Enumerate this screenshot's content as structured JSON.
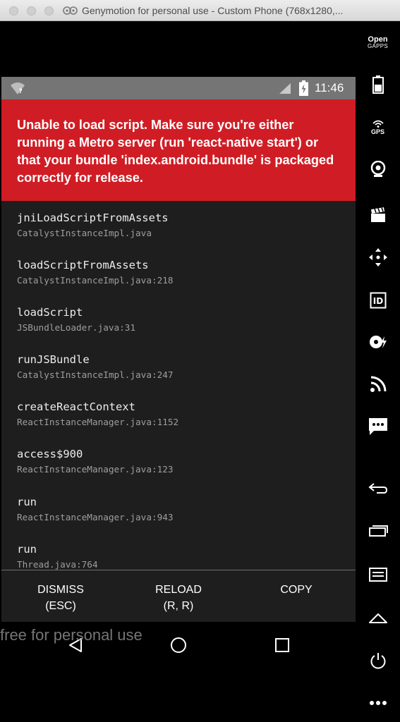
{
  "window": {
    "title": "Genymotion for personal use - Custom Phone (768x1280,..."
  },
  "status_bar": {
    "time": "11:46"
  },
  "redbox": {
    "message": "Unable to load script. Make sure you're either running a Metro server (run 'react-native start') or that your bundle 'index.android.bundle' is packaged correctly for release."
  },
  "stack_frames": [
    {
      "method": "jniLoadScriptFromAssets",
      "file": "CatalystInstanceImpl.java"
    },
    {
      "method": "loadScriptFromAssets",
      "file": "CatalystInstanceImpl.java:218"
    },
    {
      "method": "loadScript",
      "file": "JSBundleLoader.java:31"
    },
    {
      "method": "runJSBundle",
      "file": "CatalystInstanceImpl.java:247"
    },
    {
      "method": "createReactContext",
      "file": "ReactInstanceManager.java:1152"
    },
    {
      "method": "access$900",
      "file": "ReactInstanceManager.java:123"
    },
    {
      "method": "run",
      "file": "ReactInstanceManager.java:943"
    },
    {
      "method": "run",
      "file": "Thread.java:764"
    }
  ],
  "buttons": {
    "dismiss": {
      "line1": "DISMISS",
      "line2": "(ESC)"
    },
    "reload": {
      "line1": "RELOAD",
      "line2": "(R, R)"
    },
    "copy": {
      "line1": "COPY"
    }
  },
  "watermark": "free for personal use",
  "toolbar": {
    "opengapps": {
      "line1": "Open",
      "line2": "GAPPS"
    },
    "gps_label": "GPS",
    "id_label": "ID",
    "icons": [
      "opengapps-icon",
      "battery-icon",
      "gps-icon",
      "webcam-icon",
      "clapperboard-icon",
      "move-arrows-icon",
      "device-id-icon",
      "disk-io-icon",
      "cast-icon",
      "sms-icon",
      "back-icon",
      "recent-apps-icon",
      "menu-icon",
      "home-icon",
      "power-icon",
      "more-icon"
    ]
  },
  "colors": {
    "redbox": "#d01d25",
    "stack_background": "#1e1e1e",
    "status_bar": "#757575"
  }
}
